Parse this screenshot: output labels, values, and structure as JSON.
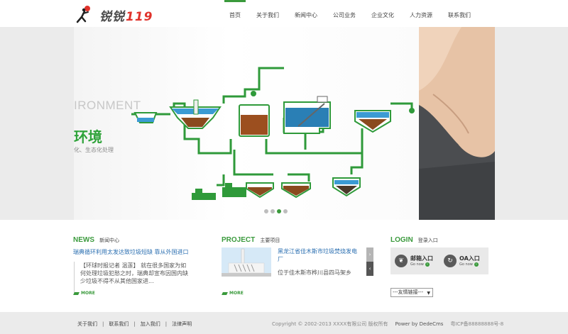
{
  "header": {
    "logo_text": "锐锐",
    "logo_number": "119",
    "nav": [
      "首页",
      "关于我们",
      "新闻中心",
      "公司业务",
      "企业文化",
      "人力资源",
      "联系我们"
    ]
  },
  "banner": {
    "eng_text": "IRONMENT",
    "title": "环境",
    "subtitle": "化、生态化处理",
    "slides": 4,
    "active_slide": 3
  },
  "news": {
    "title_en": "NEWS",
    "title_cn": "新闻中心",
    "headline": "瑞典循环利用太发达致垃圾短缺 靠从外国进口",
    "excerpt": "【环球时报记者 温莲】 就在很多国家为如何处理垃圾犯愁之时，瑞典却宣布因国内缺少垃圾不得不从其他国家进...",
    "more": "MORE"
  },
  "project": {
    "title_en": "PROJECT",
    "title_cn": "主要项目",
    "item_title": "黑龙江省佳木斯市垃圾焚烧发电厂",
    "item_desc": "位于佳木斯市桦川县四马架乡",
    "prev_arrow": "›",
    "next_arrow": "‹",
    "more": "MORE"
  },
  "login": {
    "title_en": "LOGIN",
    "title_cn": "登录入口",
    "mail_label": "邮箱入口",
    "oa_label": "OA入口",
    "go_text": "Go now",
    "friend_links": "---友情链接---"
  },
  "footer": {
    "links": [
      "关于我们",
      "联系我们",
      "加入我们",
      "法律声明"
    ],
    "copyright": "Copyright © 2002-2013 XXXX有限公司 版权所有",
    "powered": "Power by DedeCms",
    "icp": "粤ICP备88888888号-8"
  },
  "colors": {
    "accent": "#3a9a3c",
    "link": "#2b6fb1",
    "logo_number": "#e0322b"
  }
}
